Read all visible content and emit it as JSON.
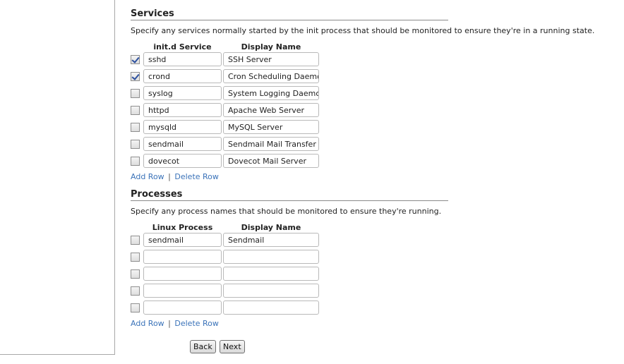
{
  "services": {
    "title": "Services",
    "description": "Specify any services normally started by the init process that should be monitored to ensure they're in a running state.",
    "col_service": "init.d Service",
    "col_display": "Display Name",
    "rows": [
      {
        "checked": true,
        "service": "sshd",
        "display": "SSH Server"
      },
      {
        "checked": true,
        "service": "crond",
        "display": "Cron Scheduling Daemon"
      },
      {
        "checked": false,
        "service": "syslog",
        "display": "System Logging Daemon"
      },
      {
        "checked": false,
        "service": "httpd",
        "display": "Apache Web Server"
      },
      {
        "checked": false,
        "service": "mysqld",
        "display": "MySQL Server"
      },
      {
        "checked": false,
        "service": "sendmail",
        "display": "Sendmail Mail Transfer Agent"
      },
      {
        "checked": false,
        "service": "dovecot",
        "display": "Dovecot Mail Server"
      }
    ],
    "add_row": "Add Row",
    "separator": "|",
    "delete_row": "Delete Row"
  },
  "processes": {
    "title": "Processes",
    "description": "Specify any process names that should be monitored to ensure they're running.",
    "col_process": "Linux Process",
    "col_display": "Display Name",
    "rows": [
      {
        "checked": false,
        "process": "sendmail",
        "display": "Sendmail"
      },
      {
        "checked": false,
        "process": "",
        "display": ""
      },
      {
        "checked": false,
        "process": "",
        "display": ""
      },
      {
        "checked": false,
        "process": "",
        "display": ""
      },
      {
        "checked": false,
        "process": "",
        "display": ""
      }
    ],
    "add_row": "Add Row",
    "separator": "|",
    "delete_row": "Delete Row"
  },
  "buttons": {
    "back": "Back",
    "next": "Next"
  },
  "colors": {
    "link": "#3b73b9",
    "checkmark": "#2b4f9e"
  }
}
